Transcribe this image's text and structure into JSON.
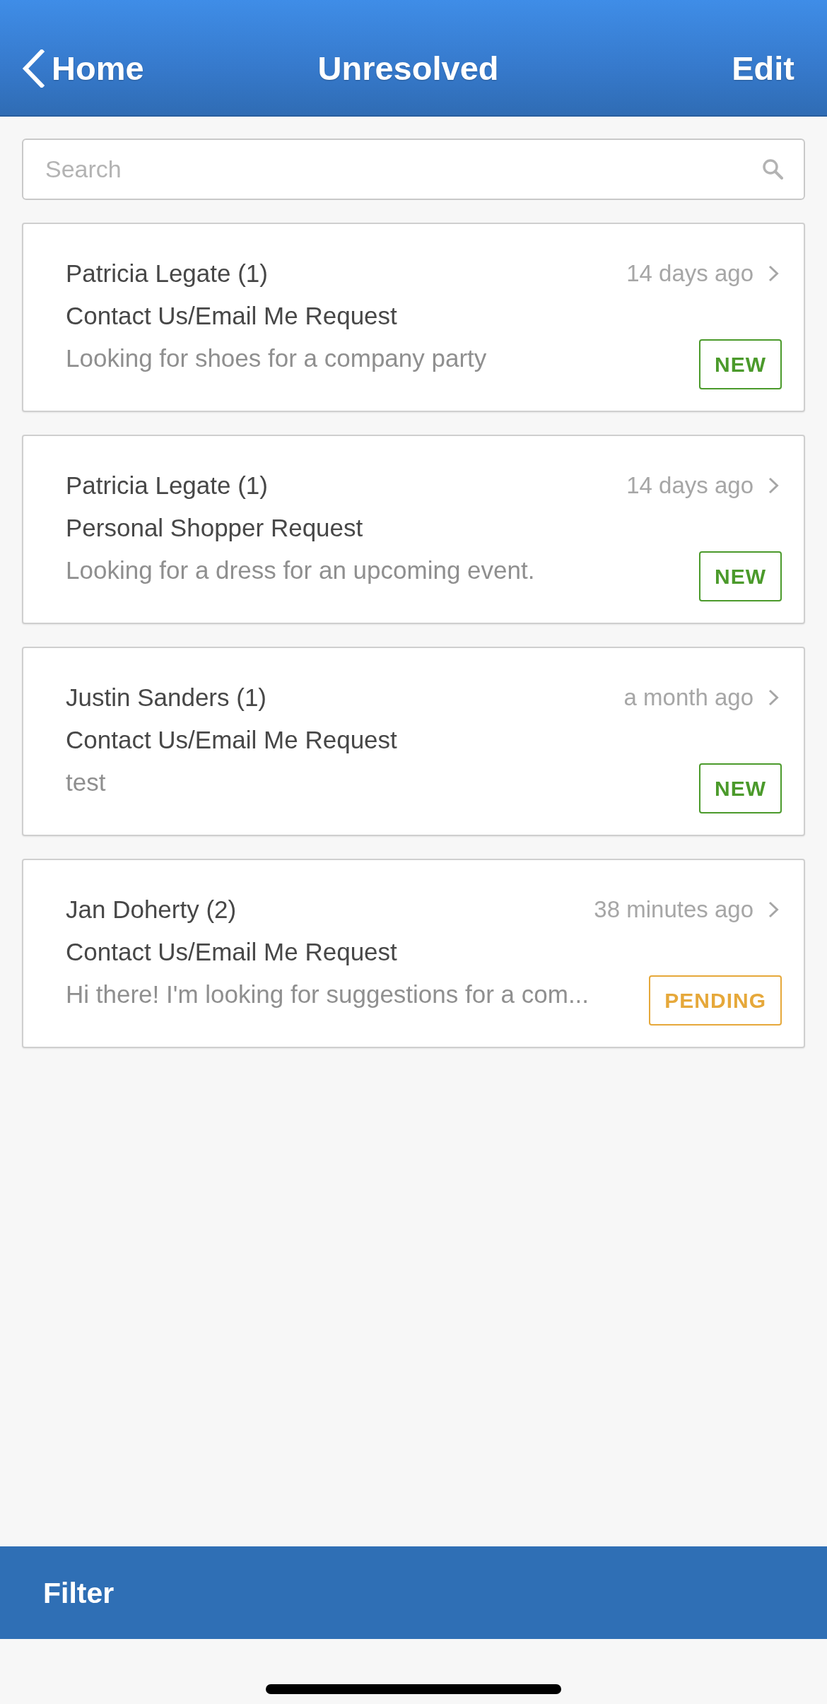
{
  "nav_bar": {
    "back": "Home",
    "title": "Unresolved",
    "action": "Edit"
  },
  "search": {
    "placeholder": "Search"
  },
  "requests": [
    {
      "name": "Patricia Legate (1)",
      "time": "14 days ago",
      "subject": "Contact Us/Email Me Request",
      "snippet": "Looking for shoes for a company party",
      "badge": {
        "label": "NEW",
        "color": "#4b9a2b"
      }
    },
    {
      "name": "Patricia Legate (1)",
      "time": "14 days ago",
      "subject": "Personal Shopper Request",
      "snippet": "Looking for a dress for an upcoming event.",
      "badge": {
        "label": "NEW",
        "color": "#4b9a2b"
      }
    },
    {
      "name": "Justin Sanders (1)",
      "time": "a month ago",
      "subject": "Contact Us/Email Me Request",
      "snippet": "test",
      "badge": {
        "label": "NEW",
        "color": "#4b9a2b"
      }
    },
    {
      "name": "Jan Doherty (2)",
      "time": "38 minutes ago",
      "subject": "Contact Us/Email Me Request",
      "snippet": "Hi there! I'm looking for suggestions for a com...",
      "badge": {
        "label": "PENDING",
        "color": "#e6a83a"
      }
    }
  ],
  "toolbar": {
    "filter": "Filter"
  }
}
